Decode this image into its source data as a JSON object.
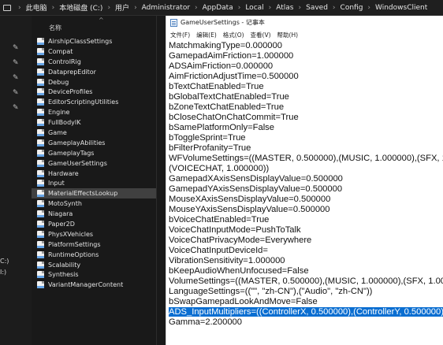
{
  "breadcrumb": [
    "此电脑",
    "本地磁盘 (C:)",
    "用户",
    "Administrator",
    "AppData",
    "Local",
    "Atlas",
    "Saved",
    "Config",
    "WindowsClient"
  ],
  "explorer": {
    "column_header": "名称",
    "drive_labels": [
      "C:)",
      "I:)"
    ],
    "selected_index": 15,
    "files": [
      "AirshipClassSettings",
      "Compat",
      "ControlRig",
      "DataprepEditor",
      "Debug",
      "DeviceProfiles",
      "EditorScriptingUtilities",
      "Engine",
      "FullBodyIK",
      "Game",
      "GameplayAbilities",
      "GameplayTags",
      "GameUserSettings",
      "Hardware",
      "Input",
      "MaterialEffectsLookup",
      "MotoSynth",
      "Niagara",
      "Paper2D",
      "PhysXVehicles",
      "PlatformSettings",
      "RuntimeOptions",
      "Scalability",
      "Synthesis",
      "VariantManagerContent"
    ]
  },
  "notepad": {
    "title": "GameUserSettings - 记事本",
    "menu": [
      "文件(F)",
      "编辑(E)",
      "格式(O)",
      "查看(V)",
      "帮助(H)"
    ],
    "selected_line": 26,
    "lines": [
      "MatchmakingType=0.000000",
      "GamepadAimFriction=1.000000",
      "ADSAimFriction=0.000000",
      "AimFrictionAdjustTime=0.500000",
      "bTextChatEnabled=True",
      "bGlobalTextChatEnabled=True",
      "bZoneTextChatEnabled=True",
      "bCloseChatOnChatCommit=True",
      "bSamePlatformOnly=False",
      "bToggleSprint=True",
      "bFilterProfanity=True",
      "WFVolumeSettings=((MASTER, 0.500000),(MUSIC, 1.000000),(SFX, 1.000000),",
      "(VOICECHAT, 1.000000))",
      "GamepadXAxisSensDisplayValue=0.500000",
      "GamepadYAxisSensDisplayValue=0.500000",
      "MouseXAxisSensDisplayValue=0.500000",
      "MouseYAxisSensDisplayValue=0.500000",
      "bVoiceChatEnabled=True",
      "VoiceChatInputMode=PushToTalk",
      "VoiceChatPrivacyMode=Everywhere",
      "VoiceChatInputDeviceId=",
      "VibrationSensitivity=1.000000",
      "bKeepAudioWhenUnfocused=False",
      "VolumeSettings=((MASTER, 0.500000),(MUSIC, 1.000000),(SFX, 1.000000)",
      "LanguageSettings=((\"\", \"zh-CN\"),(\"Audio\", \"zh-CN\"))",
      "bSwapGamepadLookAndMove=False",
      "ADS_InputMultipliers=((ControllerX, 0.500000),(ControllerY, 0.500000)",
      "Gamma=2.200000"
    ]
  }
}
